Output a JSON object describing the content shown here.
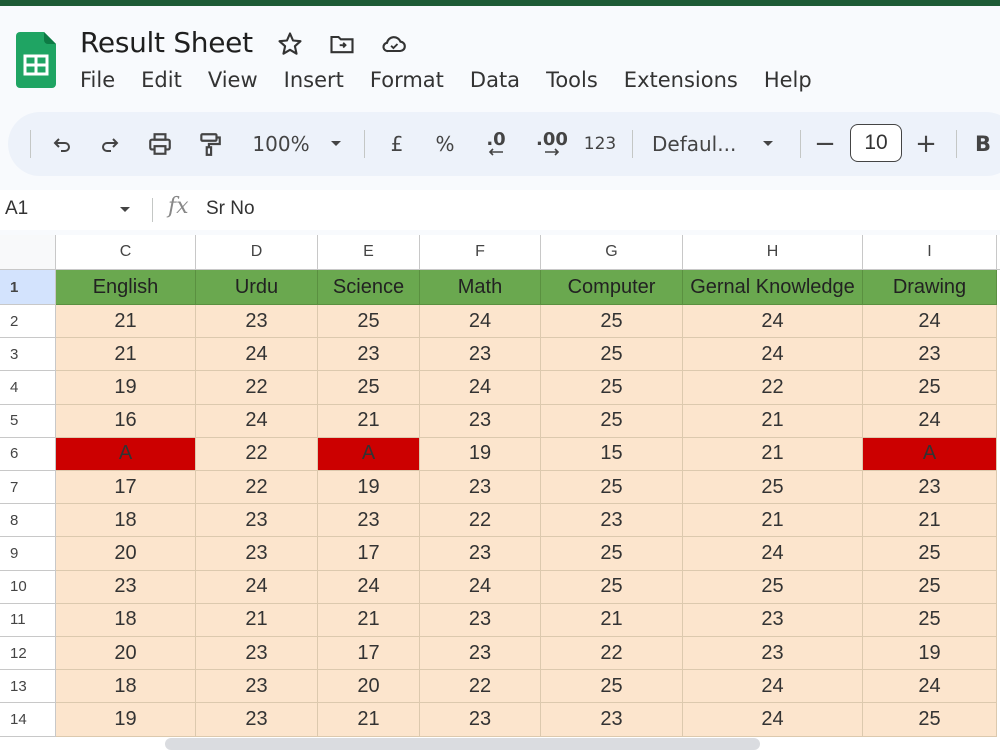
{
  "app": {
    "title": "Result Sheet",
    "menu": [
      "File",
      "Edit",
      "View",
      "Insert",
      "Format",
      "Data",
      "Tools",
      "Extensions",
      "Help"
    ]
  },
  "toolbar": {
    "zoom": "100%",
    "currency": "£",
    "percent": "%",
    "decrease_decimal": ".0",
    "increase_decimal": ".00",
    "number_format": "123",
    "font": "Defaul...",
    "font_size": "10",
    "minus": "−",
    "plus": "+",
    "bold": "B"
  },
  "formula_bar": {
    "cell_ref": "A1",
    "fx": "fx",
    "value": "Sr No"
  },
  "sheet": {
    "columns": [
      "C",
      "D",
      "E",
      "F",
      "G",
      "H",
      "I"
    ],
    "header_row_label": "1",
    "headers": [
      "English",
      "Urdu",
      "Science",
      "Math",
      "Computer",
      "Gernal Knowledge",
      "Drawing"
    ],
    "rows": [
      {
        "label": "2",
        "cells": [
          "21",
          "23",
          "25",
          "24",
          "25",
          "24",
          "24"
        ]
      },
      {
        "label": "3",
        "cells": [
          "21",
          "24",
          "23",
          "23",
          "25",
          "24",
          "23"
        ]
      },
      {
        "label": "4",
        "cells": [
          "19",
          "22",
          "25",
          "24",
          "25",
          "22",
          "25"
        ]
      },
      {
        "label": "5",
        "cells": [
          "16",
          "24",
          "21",
          "23",
          "25",
          "21",
          "24"
        ]
      },
      {
        "label": "6",
        "cells": [
          "A",
          "22",
          "A",
          "19",
          "15",
          "21",
          "A"
        ]
      },
      {
        "label": "7",
        "cells": [
          "17",
          "22",
          "19",
          "23",
          "25",
          "25",
          "23"
        ]
      },
      {
        "label": "8",
        "cells": [
          "18",
          "23",
          "23",
          "22",
          "23",
          "21",
          "21"
        ]
      },
      {
        "label": "9",
        "cells": [
          "20",
          "23",
          "17",
          "23",
          "25",
          "24",
          "25"
        ]
      },
      {
        "label": "10",
        "cells": [
          "23",
          "24",
          "24",
          "24",
          "25",
          "25",
          "25"
        ]
      },
      {
        "label": "11",
        "cells": [
          "18",
          "21",
          "21",
          "23",
          "21",
          "23",
          "25"
        ]
      },
      {
        "label": "12",
        "cells": [
          "20",
          "23",
          "17",
          "23",
          "22",
          "23",
          "19"
        ]
      },
      {
        "label": "13",
        "cells": [
          "18",
          "23",
          "20",
          "22",
          "25",
          "24",
          "24"
        ]
      },
      {
        "label": "14",
        "cells": [
          "19",
          "23",
          "21",
          "23",
          "23",
          "24",
          "25"
        ]
      }
    ]
  },
  "colors": {
    "header_fill": "#6aa84f",
    "cell_fill": "#fce5cd",
    "absent_fill": "#cc0000",
    "brand_green": "#0f9d58"
  }
}
